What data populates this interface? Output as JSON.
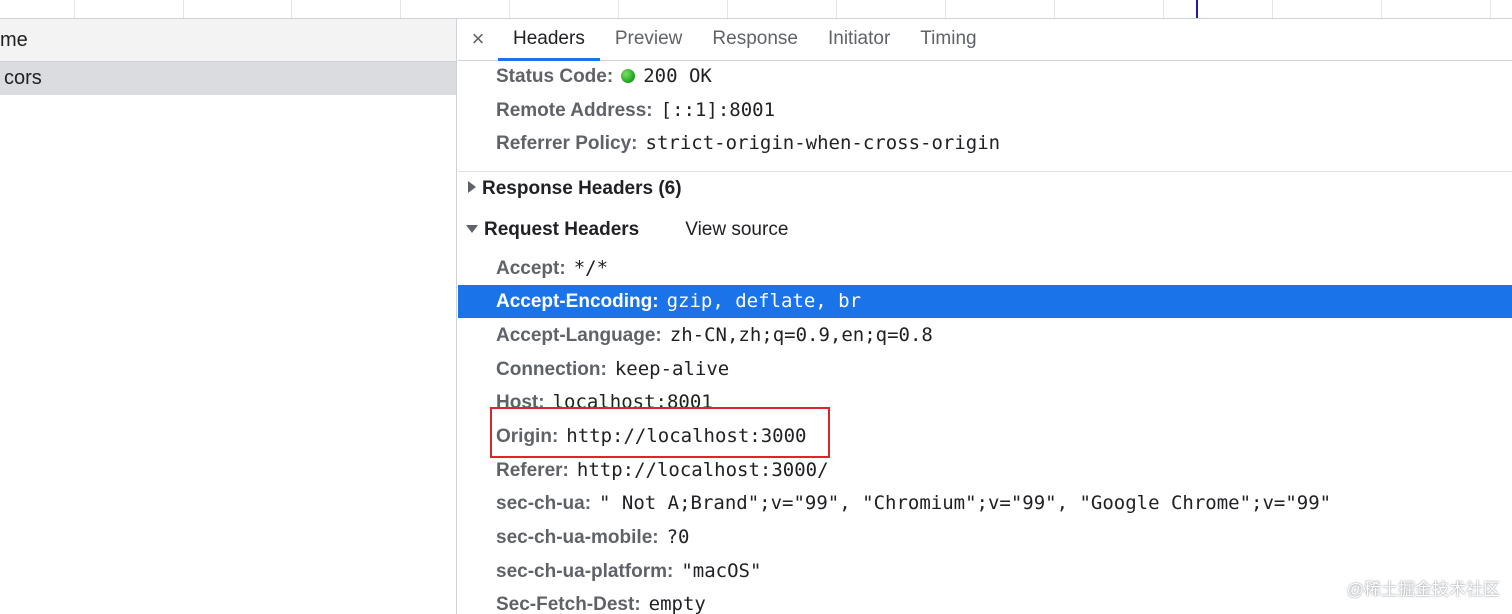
{
  "list": {
    "column_header": "me",
    "selected_request": "cors"
  },
  "tabs": {
    "close_symbol": "×",
    "items": [
      "Headers",
      "Preview",
      "Response",
      "Initiator",
      "Timing"
    ],
    "active": "Headers"
  },
  "general": {
    "status_code": {
      "key": "Status Code:",
      "value": "200 OK",
      "status_color": "#1aa11a"
    },
    "remote_address": {
      "key": "Remote Address:",
      "value": "[::1]:8001"
    },
    "referrer_policy": {
      "key": "Referrer Policy:",
      "value": "strict-origin-when-cross-origin"
    }
  },
  "response_headers": {
    "label": "Response Headers (6)",
    "expanded": false
  },
  "request_headers": {
    "label": "Request Headers",
    "view_source": "View source",
    "expanded": true,
    "rows": [
      {
        "key": "Accept:",
        "value": "*/*"
      },
      {
        "key": "Accept-Encoding:",
        "value": "gzip, deflate, br",
        "selected": true
      },
      {
        "key": "Accept-Language:",
        "value": "zh-CN,zh;q=0.9,en;q=0.8"
      },
      {
        "key": "Connection:",
        "value": "keep-alive"
      },
      {
        "key": "Host:",
        "value": "localhost:8001"
      },
      {
        "key": "Origin:",
        "value": "http://localhost:3000",
        "highlighted": true
      },
      {
        "key": "Referer:",
        "value": "http://localhost:3000/"
      },
      {
        "key": "sec-ch-ua:",
        "value": "\" Not A;Brand\";v=\"99\", \"Chromium\";v=\"99\", \"Google Chrome\";v=\"99\""
      },
      {
        "key": "sec-ch-ua-mobile:",
        "value": "?0"
      },
      {
        "key": "sec-ch-ua-platform:",
        "value": "\"macOS\""
      },
      {
        "key": "Sec-Fetch-Dest:",
        "value": "empty"
      }
    ]
  },
  "colors": {
    "selection": "#1a73e8",
    "highlight_border": "#e0242b"
  },
  "watermark": "@稀土掘金技术社区"
}
